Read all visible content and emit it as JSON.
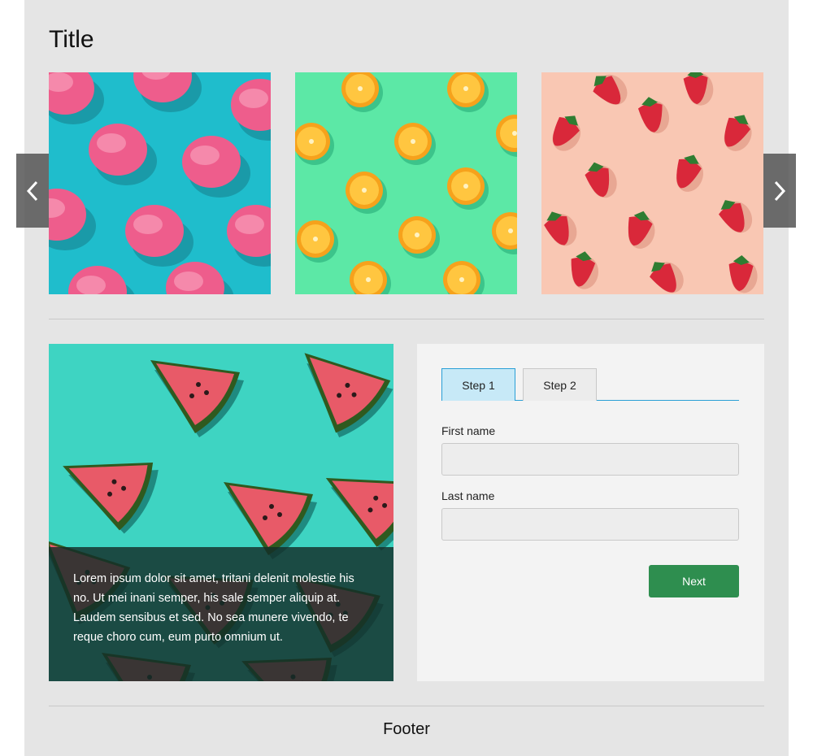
{
  "page": {
    "title": "Title",
    "footer": "Footer"
  },
  "carousel": {
    "slides": [
      {
        "name": "ice-cream",
        "bg": "#1fbdcc"
      },
      {
        "name": "oranges",
        "bg": "#5ce8a6"
      },
      {
        "name": "strawberries",
        "bg": "#f9c7b3"
      }
    ],
    "prev_icon": "chevron-left-icon",
    "next_icon": "chevron-right-icon"
  },
  "feature": {
    "image": "watermelon",
    "bg": "#3ed4c2",
    "caption": "Lorem ipsum dolor sit amet, tritani delenit molestie his no. Ut mei inani semper, his sale semper aliquip at. Laudem sensibus et sed. No sea munere vivendo, te reque choro cum, eum purto omnium ut."
  },
  "form": {
    "tabs": [
      {
        "label": "Step 1",
        "active": true
      },
      {
        "label": "Step 2",
        "active": false
      }
    ],
    "first_name_label": "First name",
    "first_name_value": "",
    "last_name_label": "Last name",
    "last_name_value": "",
    "next_label": "Next"
  },
  "colors": {
    "accent": "#2a9fd6",
    "button": "#2e8e4f",
    "active_tab": "#c7e9f7"
  }
}
